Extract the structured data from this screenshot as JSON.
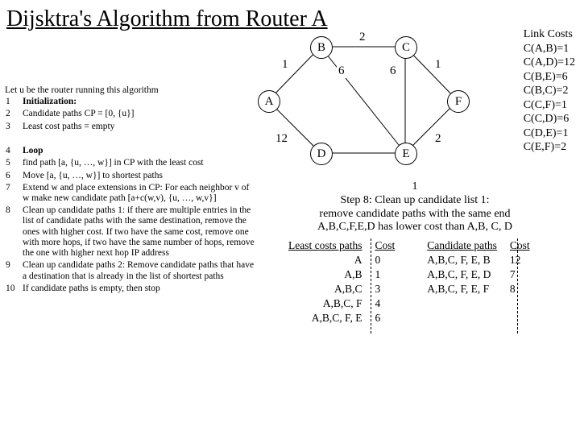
{
  "title": "Dijsktra's Algorithm from Router A",
  "graph": {
    "nodes": {
      "A": "A",
      "B": "B",
      "C": "C",
      "D": "D",
      "E": "E",
      "F": "F"
    },
    "labels": {
      "AB": "1",
      "BC": "2",
      "BE": "6",
      "CE": "6",
      "CF": "1",
      "AD": "12",
      "DE": "",
      "EF": "2"
    }
  },
  "linkcosts": {
    "title": "Link Costs",
    "rows": [
      "C(A,B)=1",
      "C(A,D)=12",
      "C(B,E)=6",
      "C(B,C)=2",
      "C(C,F)=1",
      "C(C,D)=6",
      "C(D,E)=1",
      "C(E,F)=2"
    ]
  },
  "algo": {
    "intro": "Let u be the router running this algorithm",
    "l1n": "1",
    "l1": "Initialization:",
    "l2n": "2",
    "l2": "Candidate paths CP = [0, {u}]",
    "l3n": "3",
    "l3": "Least cost paths = empty",
    "l4n": "4",
    "l4": "Loop",
    "l5n": "5",
    "l5": "find path [a, {u, …, w}] in CP with the least cost",
    "l6n": "6",
    "l6": "Move [a, {u, …, w}] to shortest paths",
    "l7n": "7",
    "l7": "Extend w and place extensions in CP: For each neighbor v of w make new candidate path [a+c(w,v), {u, …, w,v}]",
    "l8n": "8",
    "l8": "Clean up candidate paths 1: if there are multiple entries in the list of candidate paths with the same destination, remove the ones with higher cost. If two have the same cost, remove one with more hops, if two have the same number of hops, remove the one with higher next hop IP address",
    "l9n": "9",
    "l9": "Clean up candidate paths 2: Remove candidate paths that have a destination that is already in the list of shortest paths",
    "l10n": "10",
    "l10": "If candidate paths is empty, then stop"
  },
  "step": {
    "one": "1",
    "line1": "Step 8: Clean up candidate list 1:",
    "line2": "remove candidate paths with the same end",
    "line3": "A,B,C,F,E,D has lower cost than A,B, C, D"
  },
  "least": {
    "h1": "Least costs paths",
    "h2": "Cost",
    "r1p": "A",
    "r1c": "0",
    "r2p": "A,B",
    "r2c": "1",
    "r3p": "A,B,C",
    "r3c": "3",
    "r4p": "A,B,C, F",
    "r4c": "4",
    "r5p": "A,B,C, F, E",
    "r5c": "6"
  },
  "cand": {
    "h1": "Candidate paths",
    "h2": "Cost",
    "r1p": "A,B,C, F, E, B",
    "r1c": "12",
    "r2p": "A,B,C, F, E, D",
    "r2c": "7",
    "r3p": "A,B,C, F, E, F",
    "r3c": "8"
  }
}
